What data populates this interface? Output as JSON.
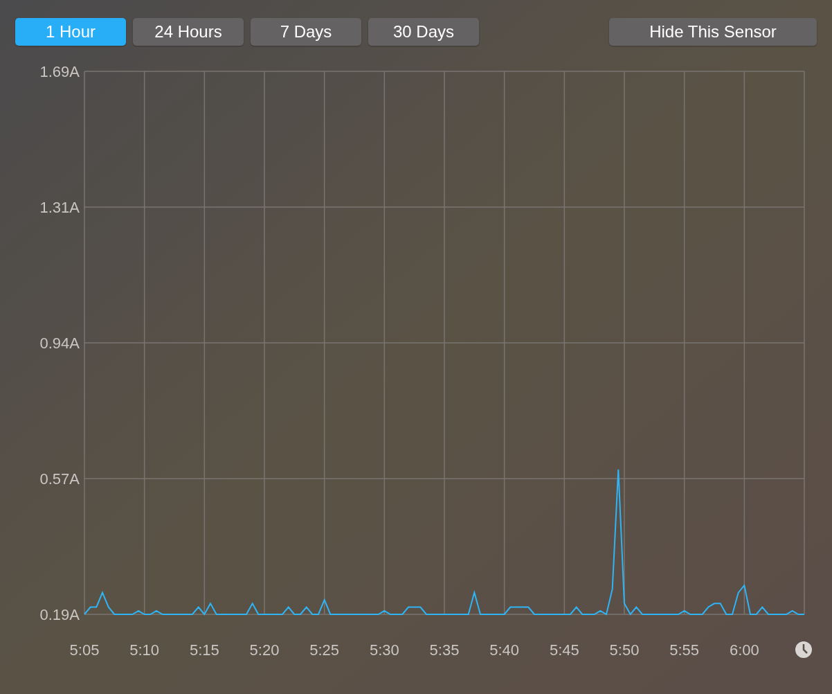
{
  "ranges": [
    {
      "label": "1 Hour",
      "selected": true
    },
    {
      "label": "24 Hours",
      "selected": false
    },
    {
      "label": "7 Days",
      "selected": false
    },
    {
      "label": "30 Days",
      "selected": false
    }
  ],
  "hide_button": "Hide This Sensor",
  "chart_data": {
    "type": "line",
    "grid": true,
    "ylim": [
      0.19,
      1.69
    ],
    "yticks": [
      {
        "value": 0.19,
        "label": "0.19A"
      },
      {
        "value": 0.565,
        "label": "0.57A"
      },
      {
        "value": 0.94,
        "label": "0.94A"
      },
      {
        "value": 1.315,
        "label": "1.31A"
      },
      {
        "value": 1.69,
        "label": "1.69A"
      }
    ],
    "categories": [
      "5:05",
      null,
      null,
      null,
      null,
      null,
      null,
      null,
      null,
      null,
      "5:10",
      null,
      null,
      null,
      null,
      null,
      null,
      null,
      null,
      null,
      "5:15",
      null,
      null,
      null,
      null,
      null,
      null,
      null,
      null,
      null,
      "5:20",
      null,
      null,
      null,
      null,
      null,
      null,
      null,
      null,
      null,
      "5:25",
      null,
      null,
      null,
      null,
      null,
      null,
      null,
      null,
      null,
      "5:30",
      null,
      null,
      null,
      null,
      null,
      null,
      null,
      null,
      null,
      "5:35",
      null,
      null,
      null,
      null,
      null,
      null,
      null,
      null,
      null,
      "5:40",
      null,
      null,
      null,
      null,
      null,
      null,
      null,
      null,
      null,
      "5:45",
      null,
      null,
      null,
      null,
      null,
      null,
      null,
      null,
      null,
      "5:50",
      null,
      null,
      null,
      null,
      null,
      null,
      null,
      null,
      null,
      "5:55",
      null,
      null,
      null,
      null,
      null,
      null,
      null,
      null,
      null,
      "6:00",
      null,
      null,
      null,
      null,
      null,
      null,
      null,
      null,
      null,
      null
    ],
    "series": [
      {
        "color": "#2fb4f5",
        "values": [
          0.19,
          0.21,
          0.21,
          0.25,
          0.21,
          0.19,
          0.19,
          0.19,
          0.19,
          0.2,
          0.19,
          0.19,
          0.2,
          0.19,
          0.19,
          0.19,
          0.19,
          0.19,
          0.19,
          0.21,
          0.19,
          0.22,
          0.19,
          0.19,
          0.19,
          0.19,
          0.19,
          0.19,
          0.22,
          0.19,
          0.19,
          0.19,
          0.19,
          0.19,
          0.21,
          0.19,
          0.19,
          0.21,
          0.19,
          0.19,
          0.23,
          0.19,
          0.19,
          0.19,
          0.19,
          0.19,
          0.19,
          0.19,
          0.19,
          0.19,
          0.2,
          0.19,
          0.19,
          0.19,
          0.21,
          0.21,
          0.21,
          0.19,
          0.19,
          0.19,
          0.19,
          0.19,
          0.19,
          0.19,
          0.19,
          0.25,
          0.19,
          0.19,
          0.19,
          0.19,
          0.19,
          0.21,
          0.21,
          0.21,
          0.21,
          0.19,
          0.19,
          0.19,
          0.19,
          0.19,
          0.19,
          0.19,
          0.21,
          0.19,
          0.19,
          0.19,
          0.2,
          0.19,
          0.26,
          0.59,
          0.22,
          0.19,
          0.21,
          0.19,
          0.19,
          0.19,
          0.19,
          0.19,
          0.19,
          0.19,
          0.2,
          0.19,
          0.19,
          0.19,
          0.21,
          0.22,
          0.22,
          0.19,
          0.19,
          0.25,
          0.27,
          0.19,
          0.19,
          0.21,
          0.19,
          0.19,
          0.19,
          0.19,
          0.2,
          0.19,
          0.19
        ]
      }
    ]
  }
}
